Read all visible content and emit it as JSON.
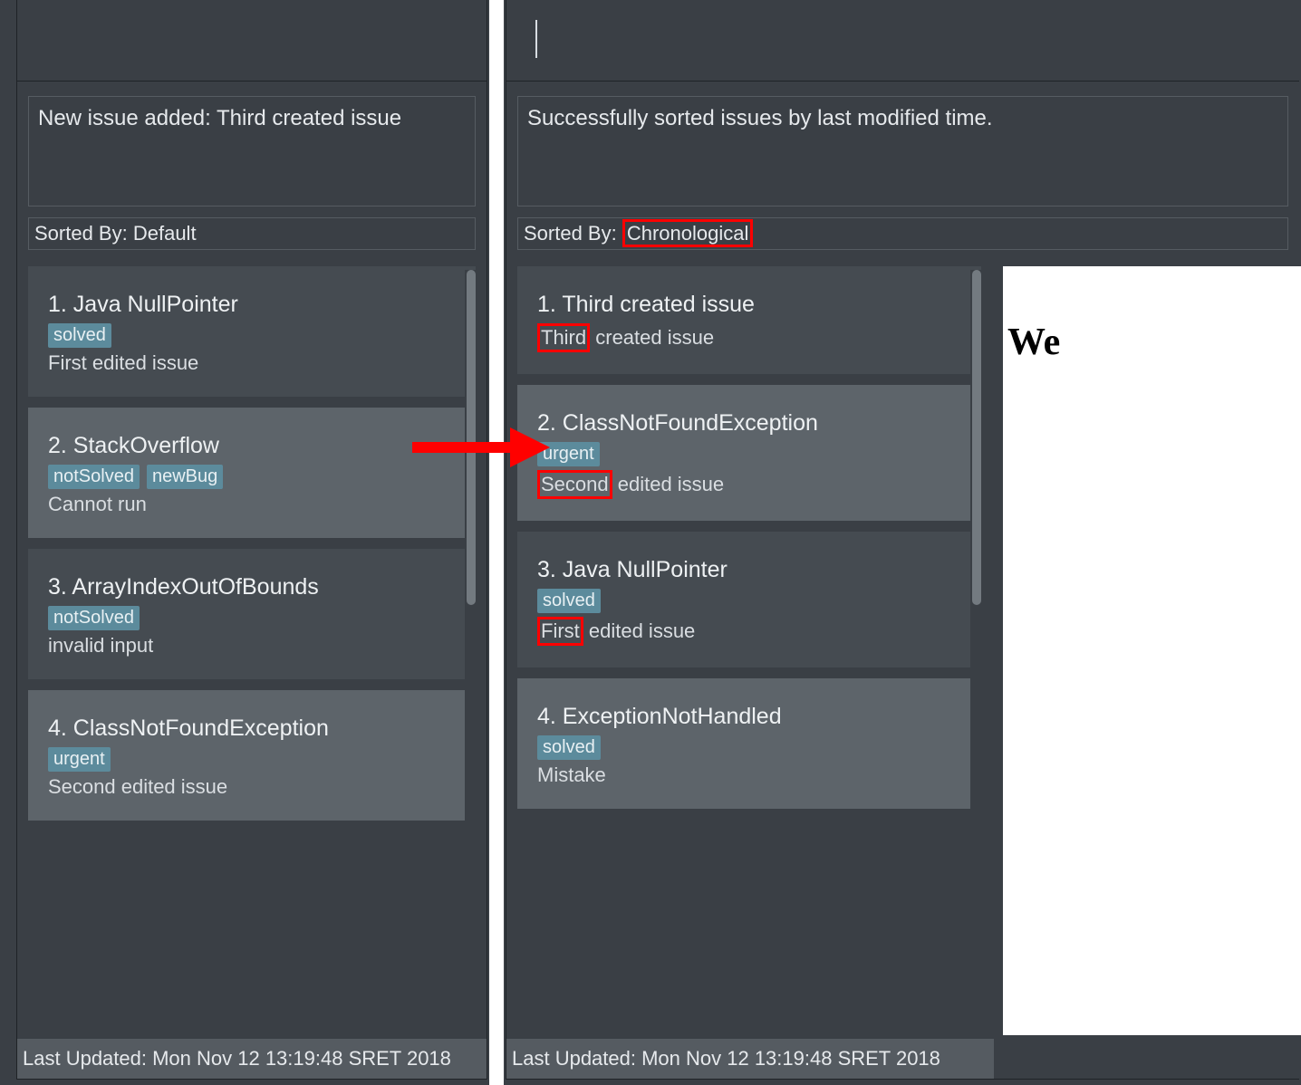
{
  "left": {
    "status": "New issue added: Third created issue",
    "sort_label": "Sorted By: ",
    "sort_value": "Default",
    "items": [
      {
        "num": "1.",
        "title": "Java NullPointer",
        "tags": [
          "solved"
        ],
        "desc_parts": [
          "First edited issue"
        ],
        "shade": "dark"
      },
      {
        "num": "2.",
        "title": "StackOverflow",
        "tags": [
          "notSolved",
          "newBug"
        ],
        "desc_parts": [
          "Cannot run"
        ],
        "shade": "light"
      },
      {
        "num": "3.",
        "title": "ArrayIndexOutOfBounds",
        "tags": [
          "notSolved"
        ],
        "desc_parts": [
          "invalid input"
        ],
        "shade": "dark"
      },
      {
        "num": "4.",
        "title": "ClassNotFoundException",
        "tags": [
          "urgent"
        ],
        "desc_parts": [
          "Second edited issue"
        ],
        "shade": "light"
      }
    ],
    "footer": "Last Updated: Mon Nov 12 13:19:48 SRET 2018"
  },
  "right": {
    "status": "Successfully sorted issues by last modified time.",
    "sort_label": "Sorted By: ",
    "sort_value": "Chronological",
    "items": [
      {
        "num": "1.",
        "title": "Third created issue",
        "tags": [],
        "desc_hl": "Third",
        "desc_rest": " created issue",
        "shade": "dark"
      },
      {
        "num": "2.",
        "title": "ClassNotFoundException",
        "tags": [
          "urgent"
        ],
        "desc_hl": "Second",
        "desc_rest": " edited issue",
        "shade": "light"
      },
      {
        "num": "3.",
        "title": "Java NullPointer",
        "tags": [
          "solved"
        ],
        "desc_hl": "First",
        "desc_rest": " edited issue",
        "shade": "dark"
      },
      {
        "num": "4.",
        "title": "ExceptionNotHandled",
        "tags": [
          "solved"
        ],
        "desc_parts": [
          "Mistake"
        ],
        "shade": "light"
      }
    ],
    "footer": "Last Updated: Mon Nov 12 13:19:48 SRET 2018",
    "welcome": "We"
  }
}
